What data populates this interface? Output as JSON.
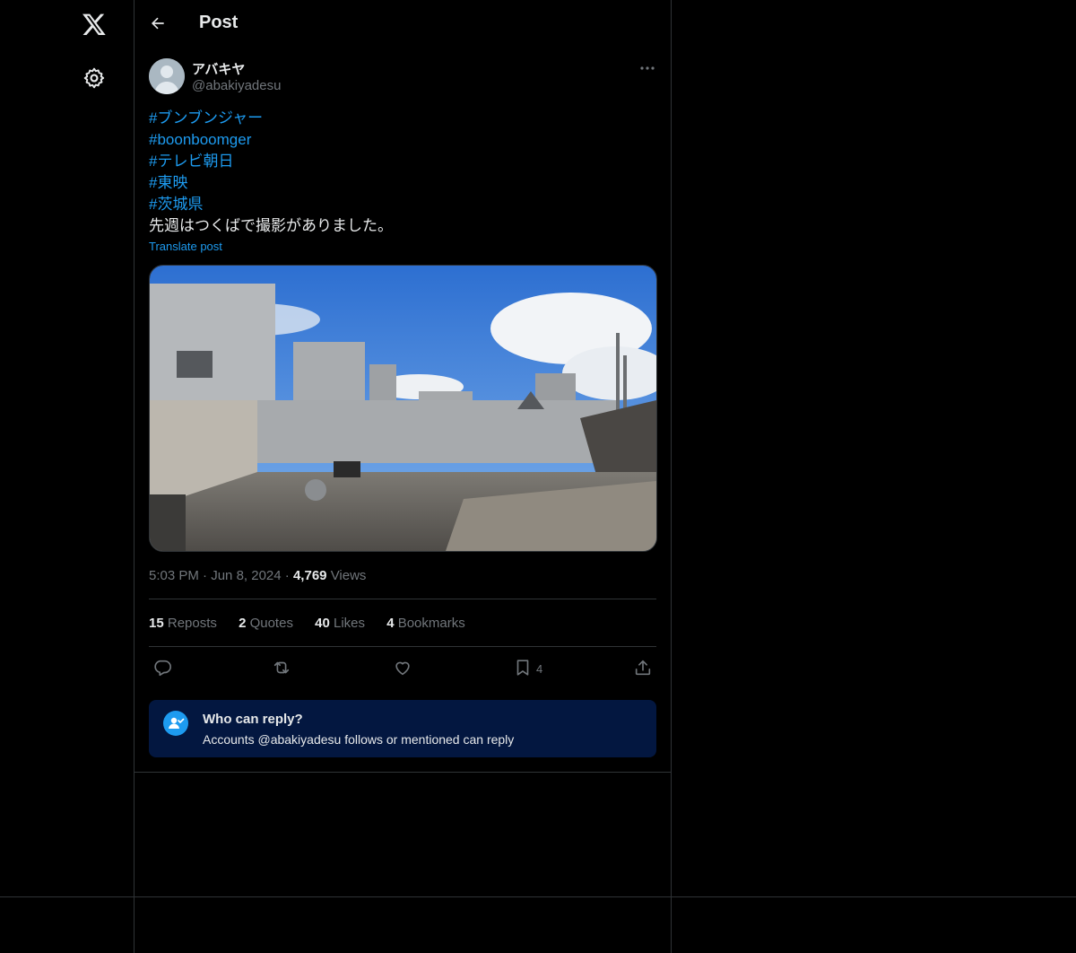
{
  "nav": {
    "logo": "x-logo-icon",
    "settings": "gear-icon"
  },
  "header": {
    "title": "Post"
  },
  "post": {
    "display_name": "アバキヤ",
    "handle": "@abakiyadesu",
    "hashtags": [
      "#ブンブンジャー",
      "#boonboomger",
      "#テレビ朝日",
      "#東映",
      "#茨城県"
    ],
    "body": "先週はつくばで撮影がありました。",
    "translate": "Translate post",
    "time": "5:03 PM",
    "sep1": "·",
    "date": "Jun 8, 2024",
    "sep2": "·",
    "views_count": "4,769",
    "views_label": "Views"
  },
  "stats": {
    "reposts_count": "15",
    "reposts_label": "Reposts",
    "quotes_count": "2",
    "quotes_label": "Quotes",
    "likes_count": "40",
    "likes_label": "Likes",
    "bookmarks_count": "4",
    "bookmarks_label": "Bookmarks"
  },
  "actions": {
    "bookmark_count": "4"
  },
  "reply_restriction": {
    "title": "Who can reply?",
    "subtitle": "Accounts @abakiyadesu follows or mentioned can reply"
  },
  "colors": {
    "accent": "#1d9bf0",
    "muted": "#71767b",
    "border": "#2f3336",
    "reply_bg": "#031740"
  }
}
